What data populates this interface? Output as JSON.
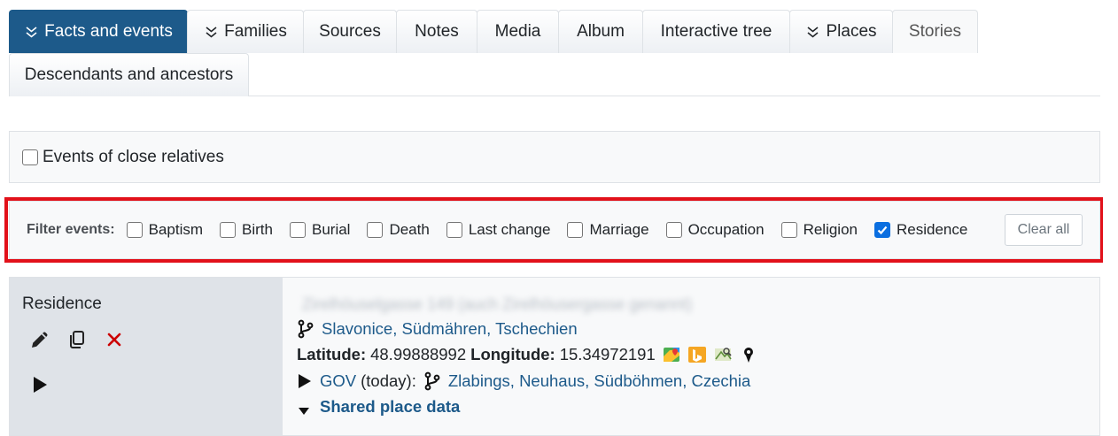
{
  "tabs": {
    "row1": [
      {
        "label": "Facts and events",
        "active": true,
        "chevron": true
      },
      {
        "label": "Families",
        "chevron": true
      },
      {
        "label": "Sources"
      },
      {
        "label": "Notes"
      },
      {
        "label": "Media"
      },
      {
        "label": "Album"
      },
      {
        "label": "Interactive tree"
      },
      {
        "label": "Places",
        "chevron": true
      },
      {
        "label": "Stories",
        "muted": true
      }
    ],
    "row2": [
      {
        "label": "Descendants and ancestors"
      }
    ]
  },
  "relatives": {
    "label": "Events of close relatives",
    "checked": false
  },
  "filter": {
    "label": "Filter events:",
    "options": [
      {
        "label": "Baptism",
        "checked": false
      },
      {
        "label": "Birth",
        "checked": false
      },
      {
        "label": "Burial",
        "checked": false
      },
      {
        "label": "Death",
        "checked": false
      },
      {
        "label": "Last change",
        "checked": false
      },
      {
        "label": "Marriage",
        "checked": false
      },
      {
        "label": "Occupation",
        "checked": false
      },
      {
        "label": "Religion",
        "checked": false
      },
      {
        "label": "Residence",
        "checked": true
      }
    ],
    "clear_label": "Clear all"
  },
  "fact": {
    "type": "Residence",
    "address_blurred": "Zirelhöuselgasse 149 (auch Zirelhöusergasse genannt)",
    "place": "Slavonice, Südmähren, Tschechien",
    "latitude_label": "Latitude:",
    "latitude": "48.99888992",
    "longitude_label": "Longitude:",
    "longitude": "15.34972191",
    "map_icons": [
      "google-maps-icon",
      "bing-maps-icon",
      "openstreetmap-icon",
      "pin-icon"
    ],
    "gov_label": "GOV",
    "gov_suffix": "(today):",
    "gov_places": [
      "Zlabings",
      "Neuhaus",
      "Südböhmen",
      "Czechia"
    ],
    "gov_sep": ", ",
    "shared_label": "Shared place data"
  },
  "colors": {
    "accent": "#1d5a8a",
    "highlight": "#e2111a",
    "checkbox_checked": "#0b6fe0",
    "delete": "#cc0000"
  }
}
